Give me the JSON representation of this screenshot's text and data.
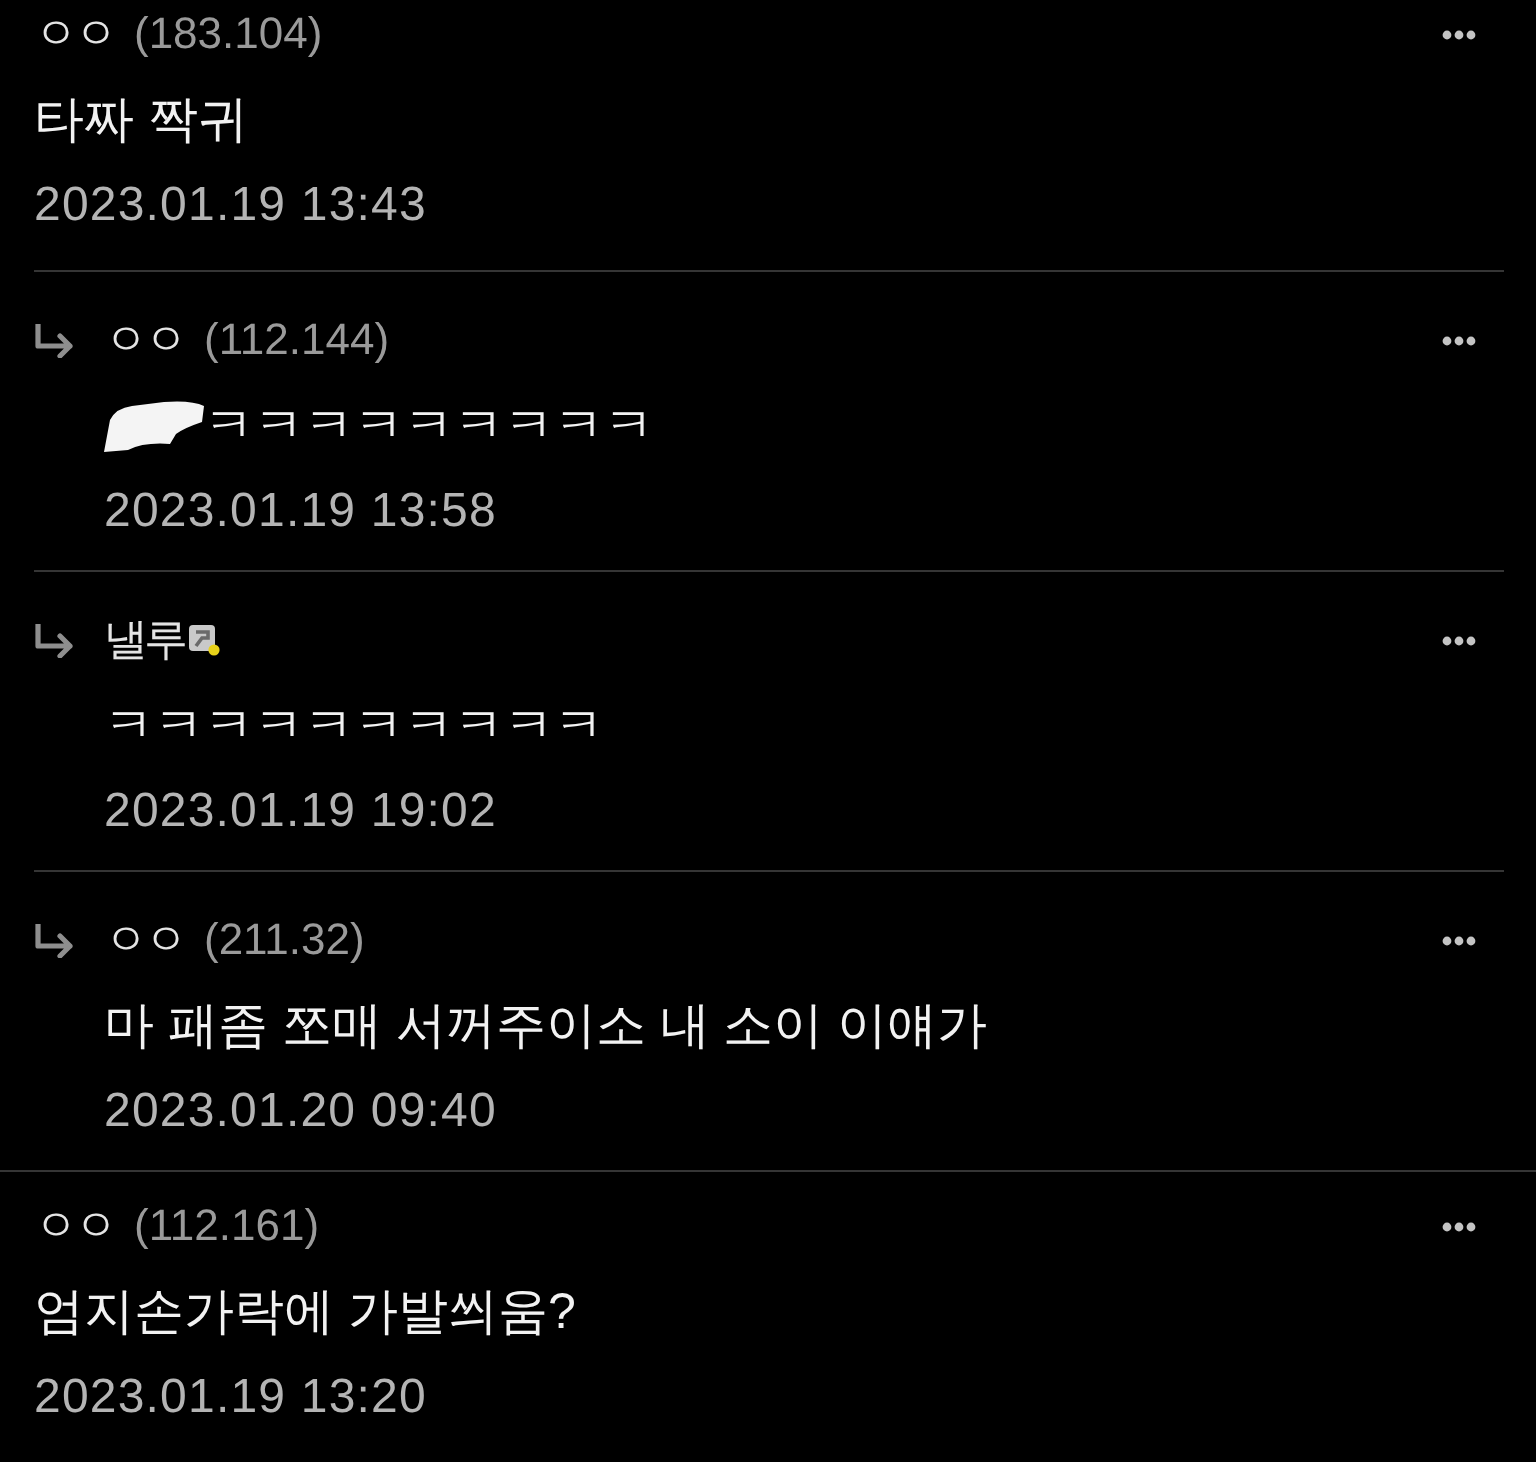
{
  "comments": [
    {
      "reply": false,
      "author": "ㅇㅇ",
      "ip": "(183.104)",
      "badge": false,
      "redacted": false,
      "text": "타짜 짝귀",
      "date": "2023.01.19 13:43"
    },
    {
      "reply": true,
      "author": "ㅇㅇ",
      "ip": "(112.144)",
      "badge": false,
      "redacted": true,
      "text": "ㅋㅋㅋㅋㅋㅋㅋㅋㅋ",
      "date": "2023.01.19 13:58"
    },
    {
      "reply": true,
      "author": "낼루",
      "badge": true,
      "redacted": false,
      "text": "ㅋㅋㅋㅋㅋㅋㅋㅋㅋㅋ",
      "date": "2023.01.19 19:02"
    },
    {
      "reply": true,
      "author": "ㅇㅇ",
      "ip": "(211.32)",
      "badge": false,
      "redacted": false,
      "text": "마 패좀 쪼매 서꺼주이소 내 소이 이얘가",
      "date": "2023.01.20 09:40"
    },
    {
      "reply": false,
      "author": "ㅇㅇ",
      "ip": "(112.161)",
      "badge": false,
      "redacted": false,
      "text": "엄지손가락에 가발씌움?",
      "date": "2023.01.19 13:20"
    }
  ]
}
